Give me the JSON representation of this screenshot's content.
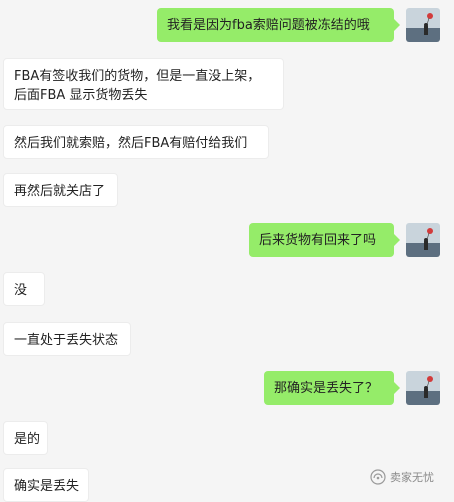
{
  "chat": {
    "messages": [
      {
        "side": "out",
        "text": "我看是因为fba索赔问题被冻结的哦"
      },
      {
        "side": "in",
        "lines": [
          "FBA有签收我们的货物，但是一直没上架，",
          "后面FBA 显示货物丢失"
        ]
      },
      {
        "side": "in",
        "text": "然后我们就索赔，然后FBA有赔付给我们"
      },
      {
        "side": "in",
        "text": "再然后就关店了"
      },
      {
        "side": "out",
        "text": "后来货物有回来了吗"
      },
      {
        "side": "in",
        "text": "没"
      },
      {
        "side": "in",
        "text": "一直处于丢失状态"
      },
      {
        "side": "out",
        "text": "那确实是丢失了？"
      },
      {
        "side": "in",
        "text": "是的"
      },
      {
        "side": "in",
        "text": "确实是丢失"
      }
    ]
  },
  "watermark": {
    "text": "卖家无忧",
    "icon": "wechat-official-account-icon"
  },
  "colors": {
    "background": "#f5f5f5",
    "outgoing_bubble": "#95ec69",
    "incoming_bubble": "#ffffff"
  },
  "avatar": {
    "icon": "seaside-photo-avatar-icon"
  }
}
